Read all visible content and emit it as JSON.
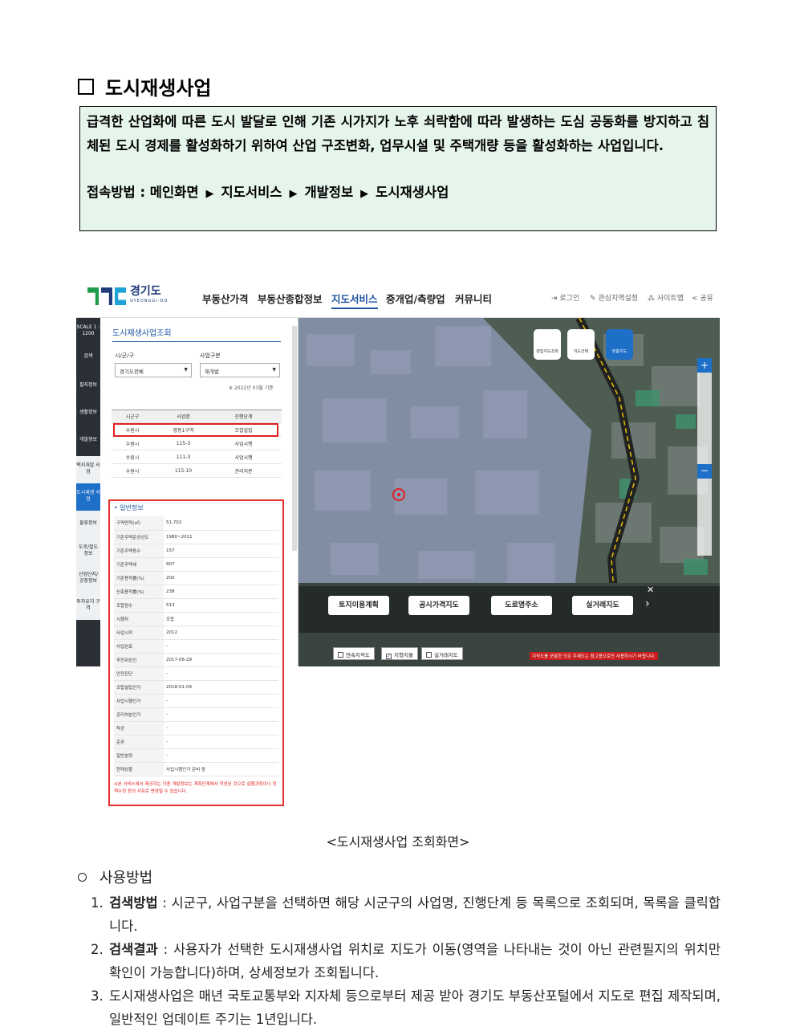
{
  "section_title": "도시재생사업",
  "description": {
    "text": "급격한 산업화에 따른 도시 발달로 인해 기존 시가지가 노후 쇠락함에 따라 발생하는 도심 공동화를 방지하고 침체된 도시 경제를 활성화하기 위하여 산업 구조변화, 업무시설 및 주택개량 등을 활성화하는 사업입니다.",
    "access_label": "접속방법 : 메인화면",
    "access_steps": [
      "지도서비스",
      "개발정보",
      "도시재생사업"
    ],
    "arrow": "▶"
  },
  "screenshot": {
    "logo_name": "경기도",
    "logo_sub": "GYEONGGI-DO",
    "logo_colors": [
      "#1f9a48",
      "#1f3b7a",
      "#1fa3d6"
    ],
    "gnb": [
      "부동산가격",
      "부동산종합정보",
      "지도서비스",
      "중개업/측량업",
      "커뮤니티"
    ],
    "gnb_active": "지도서비스",
    "util": [
      "로그인",
      "관심지역설정",
      "사이트맵",
      "공유"
    ],
    "left_nav": [
      "SCALE 1 : 1200",
      "검색",
      "필지정보",
      "생활정보",
      "개발정보",
      "택지개발 사업",
      "도시재생 사업",
      "물류정보",
      "도로/철도 정보",
      "산업단지/ 공장정보",
      "투자유치 구역"
    ],
    "panel_title": "도시재생사업조회",
    "filter_labels": [
      "시/군/구",
      "사업구분"
    ],
    "filter_values": [
      "경기도전체",
      "재개발"
    ],
    "standard_note": "※ 2022년 03월 기준",
    "list_headers": [
      "시군구",
      "사업명",
      "진행단계"
    ],
    "list_rows": [
      [
        "수원시",
        "영동1구역",
        "조합설립"
      ],
      [
        "수원시",
        "115-3",
        "사업시행"
      ],
      [
        "수원시",
        "111-3",
        "사업시행"
      ],
      [
        "수원시",
        "115-10",
        "관리처분"
      ]
    ],
    "general_title": "• 일반정보",
    "general_rows": [
      [
        "구역면적(㎡)",
        "51,702"
      ],
      [
        "기존주택준공년도",
        "1980~2011"
      ],
      [
        "기존주택동수",
        "157"
      ],
      [
        "기존주택세",
        "907"
      ],
      [
        "기존용적률(%)",
        "200"
      ],
      [
        "신축용적률(%)",
        "238"
      ],
      [
        "조합원수",
        "513"
      ],
      [
        "시행자",
        "조합"
      ],
      [
        "사업시작",
        "2012"
      ],
      [
        "사업완료",
        "-"
      ],
      [
        "추진위승인",
        "2017-06-29"
      ],
      [
        "안전진단",
        "-"
      ],
      [
        "조합설립인가",
        "2018-01-09"
      ],
      [
        "사업시행인가",
        "-"
      ],
      [
        "관리처분인가",
        "-"
      ],
      [
        "착공",
        "-"
      ],
      [
        "준공",
        "-"
      ],
      [
        "일반분양",
        "-"
      ],
      [
        "현재상황",
        "사업시행인가 준비 중"
      ]
    ],
    "general_note": "※본 서비스에서 제공하는 각종 개발정보는 계획단계에서 작성된 것으로 실행과정이나 정책수정 등의 사유로 변경될 수 있습니다.",
    "map_tools": [
      "편집지도조회",
      "지도선택",
      "맞춤지도"
    ],
    "map_buttons": [
      "토지이용계획",
      "공시가격지도",
      "도로명주소",
      "실거래지도"
    ],
    "map_checks": [
      {
        "label": "연속지적도",
        "checked": false
      },
      {
        "label": "지형지물",
        "checked": true
      },
      {
        "label": "실거래지도",
        "checked": false
      }
    ],
    "map_warning": "지적도를 포함한 모든 주제도는 참고용으로만 사용하시기 바랍니다."
  },
  "caption": "<도시재생사업 조회화면>",
  "usage_title": "사용방법",
  "usage_items": [
    {
      "num": "1.",
      "bold": "검색방법",
      "text": " : 시군구, 사업구분을 선택하면 해당 시군구의 사업명, 진행단계 등 목록으로 조회되며, 목록을 클릭합니다."
    },
    {
      "num": "2.",
      "bold": "검색결과",
      "text": " : 사용자가 선택한 도시재생사업 위치로 지도가 이동(영역을 나타내는 것이 아닌 관련필지의 위치만 확인이 가능합니다)하며, 상세정보가 조회됩니다."
    },
    {
      "num": "3.",
      "bold": "",
      "text": "도시재생사업은 매년 국토교통부와 지자체 등으로부터 제공 받아 경기도 부동산포털에서 지도로 편집 제작되며, 일반적인 업데이트 주기는 1년입니다."
    }
  ]
}
